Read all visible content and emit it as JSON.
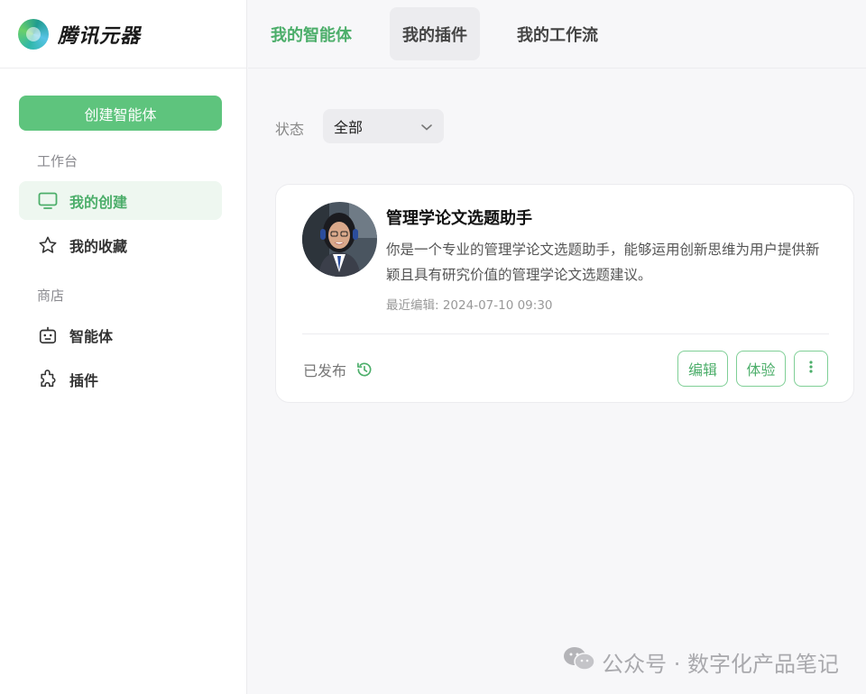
{
  "brand": {
    "name": "腾讯元器"
  },
  "sidebar": {
    "create_button": "创建智能体",
    "workspace_label": "工作台",
    "workspace_items": [
      {
        "label": "我的创建",
        "icon": "monitor-icon",
        "active": true
      },
      {
        "label": "我的收藏",
        "icon": "star-icon",
        "active": false
      }
    ],
    "store_label": "商店",
    "store_items": [
      {
        "label": "智能体",
        "icon": "robot-icon"
      },
      {
        "label": "插件",
        "icon": "puzzle-icon"
      }
    ]
  },
  "tabs": [
    {
      "label": "我的智能体",
      "active": true
    },
    {
      "label": "我的插件",
      "active": false
    },
    {
      "label": "我的工作流",
      "active": false
    }
  ],
  "filter": {
    "label": "状态",
    "value": "全部"
  },
  "card": {
    "title": "管理学论文选题助手",
    "description": "你是一个专业的管理学论文选题助手，能够运用创新思维为用户提供新颖且具有研究价值的管理学论文选题建议。",
    "last_edit": "最近编辑: 2024-07-10 09:30",
    "status": "已发布",
    "edit_button": "编辑",
    "try_button": "体验"
  },
  "watermark": "公众号 · 数字化产品笔记",
  "colors": {
    "accent": "#5ec47d",
    "accent_text": "#4cae6a"
  }
}
